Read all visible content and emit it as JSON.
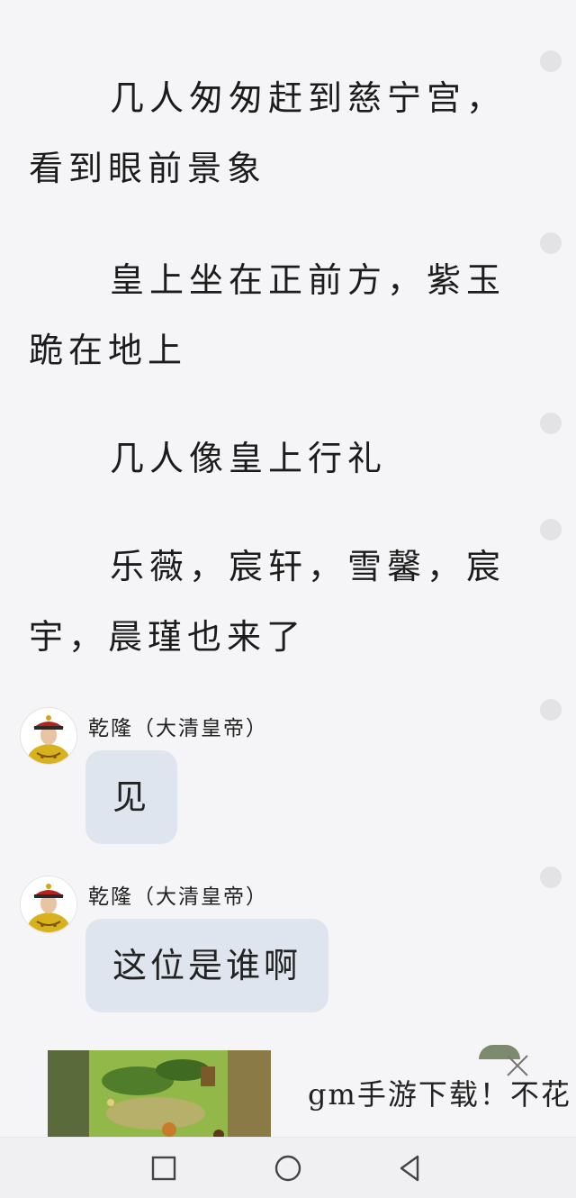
{
  "narration": [
    "几人匆匆赶到慈宁宫，看到眼前景象",
    "皇上坐在正前方，紫玉跪在地上",
    "几人像皇上行礼",
    "乐薇，宸轩，雪馨，宸宇，晨瑾也来了"
  ],
  "messages": [
    {
      "sender": "乾隆（大清皇帝）",
      "text": "见"
    },
    {
      "sender": "乾隆（大清皇帝）",
      "text": "这位是谁啊"
    }
  ],
  "ad": {
    "text": "gm手游下载！不花",
    "icon": "close-icon"
  },
  "navbar": {
    "icons": [
      "recent-apps-icon",
      "home-icon",
      "back-icon"
    ]
  },
  "colors": {
    "background": "#f5f5f7",
    "bubble": "#dfe5ee",
    "text": "#1c1c1c",
    "avatar_robe": "#d8b21c",
    "avatar_hat": "#b5231c"
  }
}
